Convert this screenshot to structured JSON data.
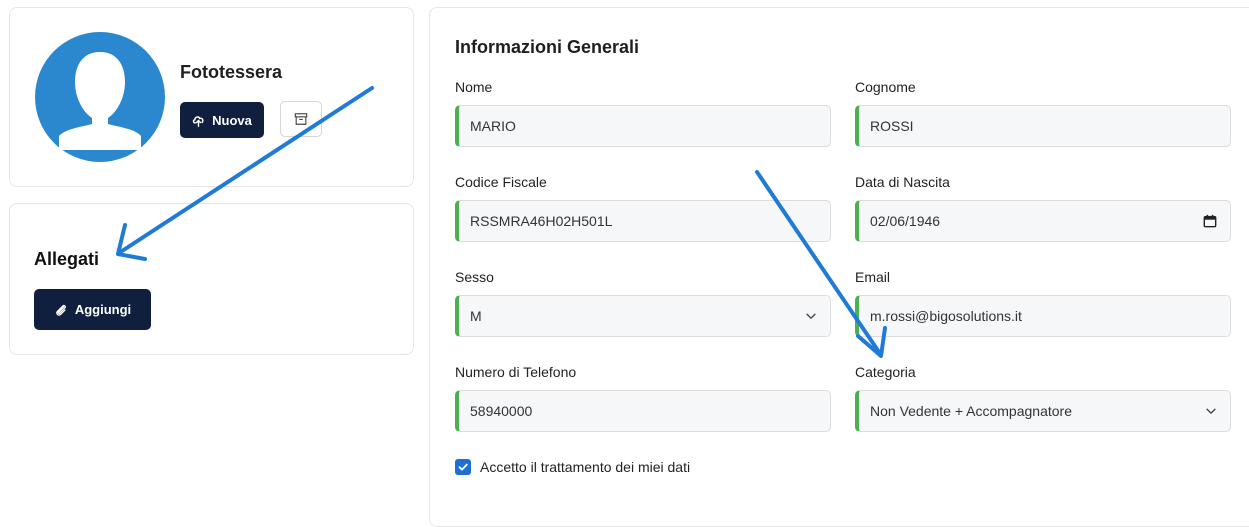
{
  "photo": {
    "title": "Fototessera",
    "new_button": "Nuova",
    "icons": [
      "user-silhouette-icon",
      "cloud-upload-icon",
      "archive-icon"
    ]
  },
  "attachments": {
    "title": "Allegati",
    "add_button": "Aggiungi",
    "icon": "paperclip-icon"
  },
  "form": {
    "title": "Informazioni Generali",
    "nome": {
      "label": "Nome",
      "value": "MARIO"
    },
    "cognome": {
      "label": "Cognome",
      "value": "ROSSI"
    },
    "codice_fiscale": {
      "label": "Codice Fiscale",
      "value": "RSSMRA46H02H501L"
    },
    "data_nascita": {
      "label": "Data di Nascita",
      "value": "02/06/1946"
    },
    "sesso": {
      "label": "Sesso",
      "value": "M"
    },
    "email": {
      "label": "Email",
      "value": "m.rossi@bigosolutions.it"
    },
    "telefono": {
      "label": "Numero di Telefono",
      "value": "58940000"
    },
    "categoria": {
      "label": "Categoria",
      "value": "Non Vedente + Accompagnatore"
    },
    "consent": {
      "label": "Accetto il trattamento dei miei dati",
      "checked": true
    }
  },
  "colors": {
    "primary": "#0f1f3d",
    "avatar": "#2b88cf",
    "valid_border": "#4caf50",
    "checkbox": "#1d6fd1",
    "annotation_arrow": "#1f7bd6"
  }
}
